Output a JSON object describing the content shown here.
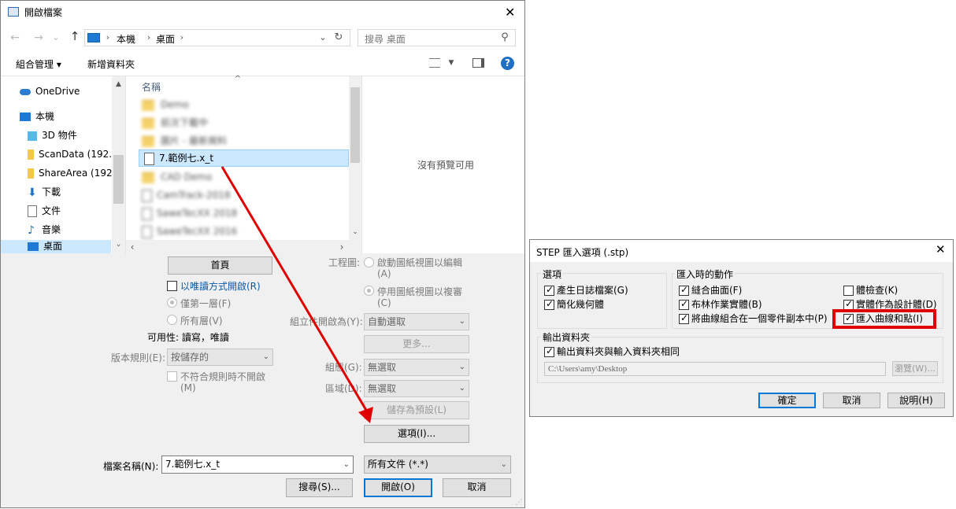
{
  "open_dialog": {
    "title": "開啟檔案",
    "address": {
      "segments": [
        "本機",
        "桌面"
      ],
      "search_placeholder": "搜尋 桌面"
    },
    "toolbar": {
      "organize": "組合管理 ▾",
      "new_folder": "新增資料夾"
    },
    "nav_items": [
      "OneDrive",
      "本機",
      "3D 物件",
      "ScanData (192.",
      "ShareArea (192",
      "下載",
      "文件",
      "音樂",
      "桌面"
    ],
    "file_list": {
      "header": "名稱",
      "blurred_rows": [
        "Demo",
        "前次下載中",
        "圖片 - 最新資料",
        "CAD Demo",
        "CamTrack-2018",
        "SaweTecXX 2018",
        "SaweTecXX 2016"
      ],
      "selected": "7.範例七.x_t"
    },
    "preview_text": "沒有預覽可用",
    "home_button": "首頁",
    "readonly_label": "以唯讀方式開啟(R)",
    "radio_first_layer": "僅第一層(F)",
    "radio_all_layers": "所有層(V)",
    "availability": "可用性: 讀寫，唯讀",
    "version_rule_label": "版本規則(E):",
    "version_rule_value": "按儲存的",
    "no_open_unmatched": "不符合規則時不開啟",
    "no_open_unmatched_2": "(M)",
    "drawing_label": "工程圖:",
    "drawing_opt1": "啟動圖紙視圖以編輯",
    "drawing_opt1_2": "(A)",
    "drawing_opt2": "停用圖紙視圖以複審",
    "drawing_opt2_2": "(C)",
    "assembly_open_label": "組立件開啟為(Y):",
    "assembly_open_value": "自動選取",
    "more_button": "更多...",
    "group_label": "組態(G):",
    "group_value": "無選取",
    "area_label": "區域(D):",
    "area_value": "無選取",
    "save_default_button": "儲存為預設(L)",
    "options_button": "選項(I)...",
    "filename_label": "檔案名稱(N):",
    "filename_value": "7.範例七.x_t",
    "filetype_value": "所有文件 (*.*)",
    "search_button": "搜尋(S)...",
    "open_button": "開啟(O)",
    "cancel_button": "取消"
  },
  "step_dialog": {
    "title": "STEP 匯入選項 (.stp)",
    "options_group": "選項",
    "opt_log": "產生日誌檔案(G)",
    "opt_simplify": "簡化幾何體",
    "import_group": "匯入時的動作",
    "act_knit": "縫合曲面(F)",
    "act_boolean": "布林作業實體(B)",
    "act_combine": "將曲線組合在一個零件副本中(P)",
    "act_check": "體檢查(K)",
    "act_solid_design": "實體作為設計體(D)",
    "act_import_curves": "匯入曲線和點(I)",
    "output_group": "輸出資料夾",
    "output_same": "輸出資料夾與輸入資料夾相同",
    "output_path": "C:\\Users\\amy\\Desktop",
    "browse_button": "瀏覽(W)...",
    "ok_button": "確定",
    "cancel_button": "取消",
    "help_button": "說明(H)"
  },
  "colors": {
    "highlight": "#e00000",
    "arrow": "#e00000",
    "selection": "#cce8ff",
    "accent": "#0078d7"
  }
}
